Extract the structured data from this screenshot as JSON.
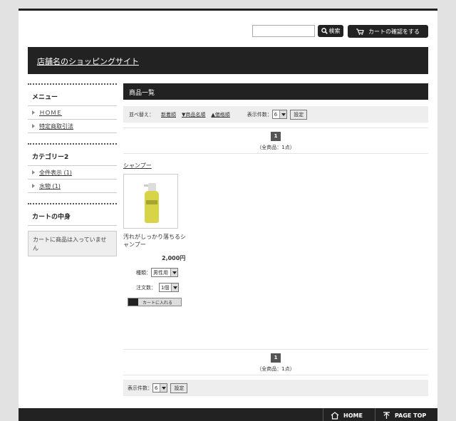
{
  "header": {
    "search_placeholder": "",
    "search_label": "検索",
    "cart_label": "カートの確認をする",
    "shop_name": "店舗名のショッピングサイト"
  },
  "sidebar": {
    "menu_title": "メニュー",
    "menu_items": [
      {
        "label": "ＨＯＭＥ"
      },
      {
        "label": "特定商取引法"
      }
    ],
    "category_title": "カテゴリー2",
    "category_items": [
      {
        "label": "全件表示 (1)"
      },
      {
        "label": "水物 (1)"
      }
    ],
    "cart_title": "カートの中身",
    "cart_empty": "カートに商品は入っていません"
  },
  "main": {
    "title": "商品一覧",
    "sort_label": "並べ替え：",
    "sort_links": [
      "新着順",
      "▼商品名順",
      "▲価格順"
    ],
    "per_page_label": "表示件数：",
    "per_page_value": "6",
    "set_label": "設定",
    "page_number": "1",
    "total_text": "（全商品：1点）",
    "category_name": "シャンプー",
    "product": {
      "name": "汚れがしっかり落ちるシャンプー",
      "price": "2,000円",
      "type_label": "種類：",
      "type_value": "男性用",
      "qty_label": "注文数：",
      "qty_value": "1個",
      "add_cart_label": "カートに入れる"
    }
  },
  "footer": {
    "home_label": "HOME",
    "pagetop_label": "PAGE TOP"
  }
}
